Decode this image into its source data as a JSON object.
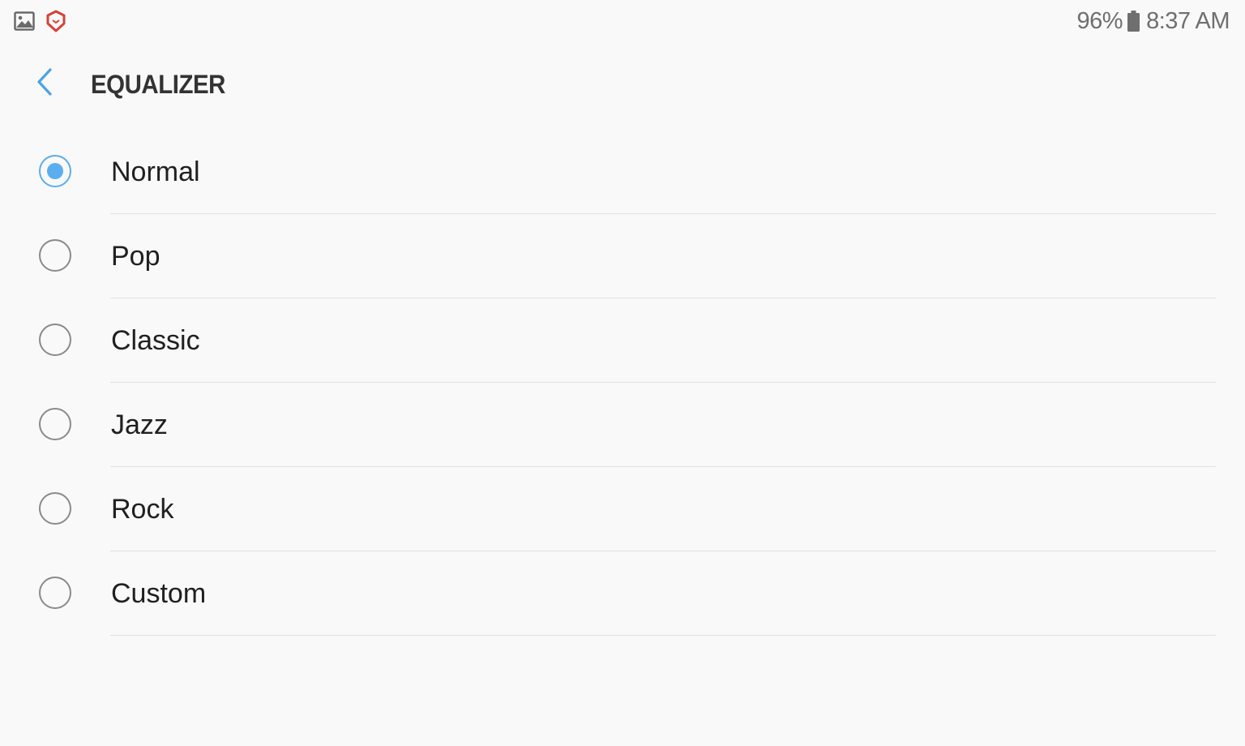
{
  "status_bar": {
    "left_icons": [
      "gallery-icon",
      "shield-app-icon"
    ],
    "battery_percent": "96%",
    "battery_icon": "battery-icon",
    "time": "8:37 AM"
  },
  "header": {
    "back_icon": "chevron-left-icon",
    "title": "EQUALIZER"
  },
  "options": [
    {
      "label": "Normal",
      "selected": true
    },
    {
      "label": "Pop",
      "selected": false
    },
    {
      "label": "Classic",
      "selected": false
    },
    {
      "label": "Jazz",
      "selected": false
    },
    {
      "label": "Rock",
      "selected": false
    },
    {
      "label": "Custom",
      "selected": false
    }
  ],
  "colors": {
    "accent": "#5aaef0",
    "background": "#f9f9f9",
    "shield_red": "#d9403a",
    "text": "#202020",
    "status_text": "#6f6f6f"
  }
}
